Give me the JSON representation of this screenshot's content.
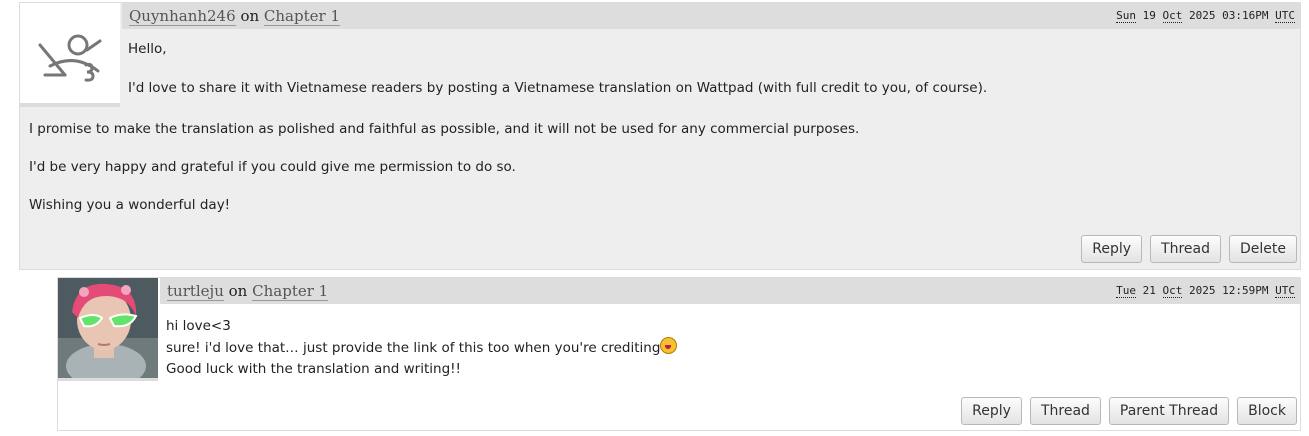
{
  "comments": [
    {
      "author": "Quynhanh246",
      "on": "on",
      "chapter": "Chapter 1",
      "timestamp": {
        "day": "Sun",
        "date": "19",
        "month": "Oct",
        "year": "2025",
        "time": "03:16PM",
        "tz": "UTC"
      },
      "avatar_icon": "default-user-icon",
      "body": [
        "Hello,",
        "I'd love to share it with Vietnamese readers by posting a Vietnamese translation on Wattpad (with full credit to you, of course).",
        "I promise to make the translation as polished and faithful as possible, and it will not be used for any commercial purposes.",
        "I'd be very happy and grateful if you could give me permission to do so.",
        "Wishing you a wonderful day!"
      ],
      "actions": [
        "Reply",
        "Thread",
        "Delete"
      ]
    },
    {
      "author": "turtleju",
      "on": "on",
      "chapter": "Chapter 1",
      "timestamp": {
        "day": "Tue",
        "date": "21",
        "month": "Oct",
        "year": "2025",
        "time": "12:59PM",
        "tz": "UTC"
      },
      "avatar_icon": "user-photo-avatar",
      "body": [
        "hi love<3",
        "sure! i'd love that… just provide the link of this too when you're crediting",
        "Good luck with the translation and writing!!"
      ],
      "actions": [
        "Reply",
        "Thread",
        "Parent Thread",
        "Block"
      ]
    }
  ],
  "colors": {
    "byline_bg": "#dddddd",
    "comment_bg": "#eeeeee",
    "link": "#555555"
  }
}
